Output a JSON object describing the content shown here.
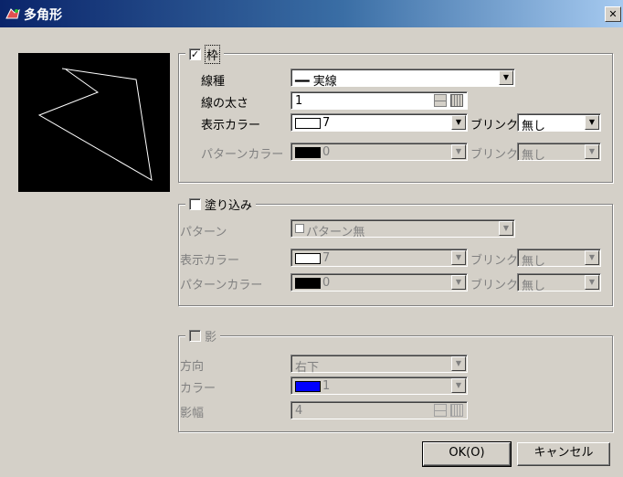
{
  "window": {
    "title": "多角形",
    "close_glyph": "✕"
  },
  "frame_section": {
    "label": "枠",
    "checked": true,
    "line_type_label": "線種",
    "line_type_value": "━━ 実線",
    "thickness_label": "線の太さ",
    "thickness_value": "1",
    "display_color_label": "表示カラー",
    "display_color_value": "7",
    "blink_label": "ブリンク",
    "blink_value": "無し",
    "pattern_color_label": "パターンカラー",
    "pattern_color_value": "0",
    "pattern_blink_label": "ブリンク",
    "pattern_blink_value": "無し"
  },
  "fill_section": {
    "label": "塗り込み",
    "checked": false,
    "pattern_label": "パターン",
    "pattern_value": "パターン無",
    "display_color_label": "表示カラー",
    "display_color_value": "7",
    "blink_label": "ブリンク",
    "blink_value": "無し",
    "pattern_color_label": "パターンカラー",
    "pattern_color_value": "0",
    "pattern_blink_label": "ブリンク",
    "pattern_blink_value": "無し"
  },
  "shadow_section": {
    "label": "影",
    "checked": false,
    "direction_label": "方向",
    "direction_value": "右下",
    "color_label": "カラー",
    "color_value": "1",
    "width_label": "影幅",
    "width_value": "4"
  },
  "buttons": {
    "ok": "OK(O)",
    "cancel": "キャンセル"
  },
  "colors": {
    "white": "#ffffff",
    "black": "#000000",
    "blue": "#0000ff"
  }
}
